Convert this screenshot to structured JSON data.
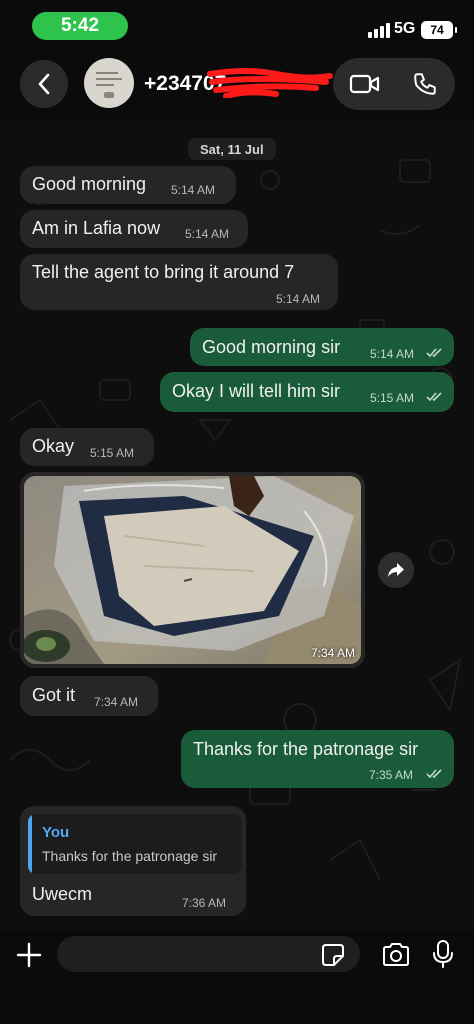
{
  "status_bar": {
    "time": "5:42",
    "network": "5G",
    "battery": "74"
  },
  "header": {
    "contact_name": "+234707",
    "back_icon": "chevron-left-icon",
    "video_icon": "video-camera-icon",
    "call_icon": "phone-icon"
  },
  "chat": {
    "date_label": "Sat, 11 Jul",
    "messages": [
      {
        "dir": "in",
        "text": "Good morning",
        "time": "5:14 AM"
      },
      {
        "dir": "in",
        "text": "Am in Lafia now",
        "time": "5:14 AM"
      },
      {
        "dir": "in",
        "text": "Tell the agent to bring it  around 7",
        "time": "5:14 AM"
      },
      {
        "dir": "out",
        "text": "Good morning sir",
        "time": "5:14 AM",
        "status": "read"
      },
      {
        "dir": "out",
        "text": "Okay I will tell him sir",
        "time": "5:15 AM",
        "status": "read"
      },
      {
        "dir": "in",
        "text": "Okay",
        "time": "5:15 AM"
      },
      {
        "dir": "in",
        "type": "image",
        "time": "7:34 AM"
      },
      {
        "dir": "in",
        "text": "Got it",
        "time": "7:34 AM"
      },
      {
        "dir": "out",
        "text": "Thanks for the patronage sir",
        "time": "7:35 AM",
        "status": "read"
      },
      {
        "dir": "in",
        "text": "Uwecm",
        "time": "7:36 AM",
        "reply_to": {
          "author": "You",
          "text": "Thanks for the patronage sir"
        }
      }
    ]
  },
  "composer": {
    "placeholder": ""
  },
  "colors": {
    "outgoing": "#1a5b3a",
    "incoming": "#262626",
    "time_pill": "#2dc34d",
    "reply_accent": "#4fa3f5"
  }
}
